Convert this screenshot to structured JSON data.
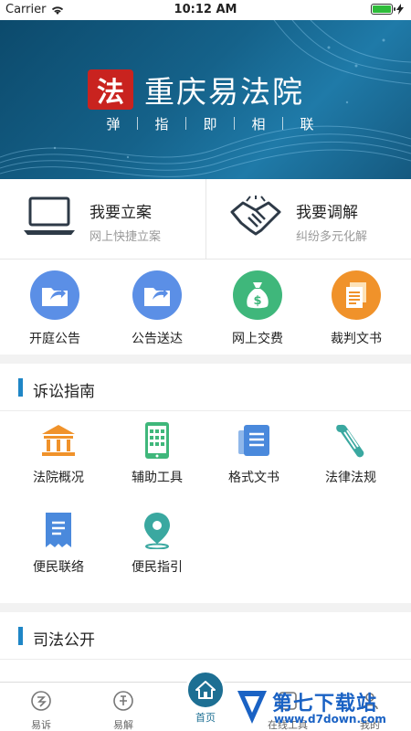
{
  "status_bar": {
    "carrier": "Carrier",
    "time": "10:12 AM",
    "battery_level": 1.0
  },
  "banner": {
    "logo_text": "法",
    "title": "重庆易法院",
    "slogan": [
      "弹",
      "指",
      "即",
      "相",
      "联"
    ]
  },
  "cases": [
    {
      "title": "我要立案",
      "subtitle": "网上快捷立案",
      "icon": "laptop-icon"
    },
    {
      "title": "我要调解",
      "subtitle": "纠纷多元化解",
      "icon": "handshake-icon"
    }
  ],
  "quick_actions": [
    {
      "label": "开庭公告",
      "icon": "folder-icon",
      "color": "#5b8fe6"
    },
    {
      "label": "公告送达",
      "icon": "folder-icon",
      "color": "#5b8fe6"
    },
    {
      "label": "网上交费",
      "icon": "money-bag-icon",
      "color": "#3fb77b"
    },
    {
      "label": "裁判文书",
      "icon": "document-icon",
      "color": "#f0922a"
    }
  ],
  "guide": {
    "title": "诉讼指南",
    "items": [
      {
        "label": "法院概况",
        "icon": "courthouse-icon",
        "color": "#f0922a"
      },
      {
        "label": "辅助工具",
        "icon": "phone-icon",
        "color": "#3fb77b"
      },
      {
        "label": "格式文书",
        "icon": "document-icon",
        "color": "#4a89dc"
      },
      {
        "label": "法律法规",
        "icon": "scroll-icon",
        "color": "#3aa8a0"
      },
      {
        "label": "便民联络",
        "icon": "receipt-icon",
        "color": "#4a89dc"
      },
      {
        "label": "便民指引",
        "icon": "location-icon",
        "color": "#3aa8a0"
      }
    ]
  },
  "judicial": {
    "title": "司法公开"
  },
  "tabbar": {
    "tabs": [
      {
        "label": "易诉",
        "icon": "yisu-icon"
      },
      {
        "label": "易解",
        "icon": "yijie-icon"
      },
      {
        "label": "首页",
        "icon": "home-icon"
      },
      {
        "label": "在线工具",
        "icon": "tools-icon"
      },
      {
        "label": "我的",
        "icon": "user-icon"
      }
    ],
    "active_color": "#1d6f93"
  },
  "watermark": {
    "text": "第七下载站",
    "url": "www.d7down.com"
  },
  "colors": {
    "accent": "#1f86c6",
    "banner": "#15628a"
  }
}
